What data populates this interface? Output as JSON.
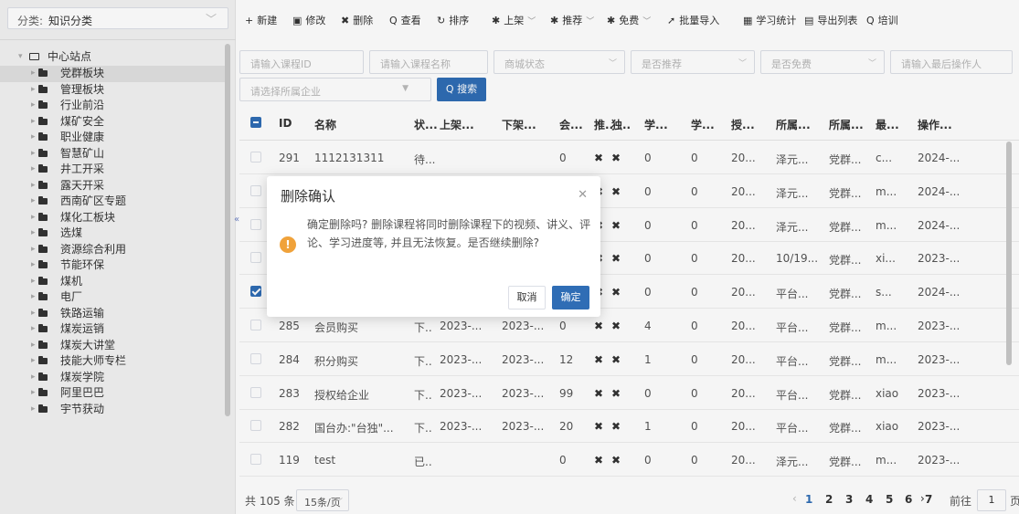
{
  "category": {
    "label": "分类:",
    "value": "知识分类"
  },
  "tree": {
    "root": "中心站点",
    "items": [
      "党群板块",
      "管理板块",
      "行业前沿",
      "煤矿安全",
      "职业健康",
      "智慧矿山",
      "井工开采",
      "露天开采",
      "西南矿区专题",
      "煤化工板块",
      "选煤",
      "资源综合利用",
      "节能环保",
      "煤机",
      "电厂",
      "铁路运输",
      "煤炭运销",
      "煤炭大讲堂",
      "技能大师专栏",
      "煤炭学院",
      "阿里巴巴",
      "宇节获动"
    ]
  },
  "toolbar": [
    {
      "glyph": "+",
      "label": "新建"
    },
    {
      "glyph": "▣",
      "label": "修改"
    },
    {
      "glyph": "✖",
      "label": "删除"
    },
    {
      "glyph": "Q",
      "label": "查看"
    },
    {
      "glyph": "↻",
      "label": "排序"
    },
    {
      "glyph": "✱",
      "label": "上架",
      "dd": true
    },
    {
      "glyph": "✱",
      "label": "推荐",
      "dd": true
    },
    {
      "glyph": "✱",
      "label": "免费",
      "dd": true
    },
    {
      "glyph": "➚",
      "label": "批量导入"
    },
    {
      "glyph": "▦",
      "label": "学习统计"
    },
    {
      "glyph": "▤",
      "label": "导出列表"
    },
    {
      "glyph": "Q",
      "label": "培训"
    }
  ],
  "filters": {
    "course_id": "请输入课程ID",
    "course_name": "请输入课程名称",
    "mall_status": "商城状态",
    "recommend": "是否推荐",
    "free": "是否免费",
    "last_operator": "请输入最后操作人",
    "company": "请选择所属企业",
    "search_button": "搜索"
  },
  "table": {
    "headers": [
      "ID",
      "名称",
      "状...",
      "上架...",
      "下架...",
      "会...",
      "推..",
      "独..",
      "学...",
      "学...",
      "授...",
      "所属...",
      "所属...",
      "最...",
      "操作..."
    ],
    "rows": [
      {
        "checked": false,
        "cells": [
          "291",
          "1112131311",
          "待...",
          "",
          "",
          "0",
          "✖",
          "✖",
          "0",
          "0",
          "20...",
          "泽元...",
          "党群...",
          "c...",
          "2024-..."
        ]
      },
      {
        "checked": false,
        "cells": [
          "",
          "",
          "",
          "",
          "",
          "",
          "✖",
          "✖",
          "0",
          "0",
          "20...",
          "泽元...",
          "党群...",
          "m...",
          "2024-..."
        ]
      },
      {
        "checked": false,
        "cells": [
          "",
          "",
          "",
          "",
          "",
          "",
          "✖",
          "✖",
          "0",
          "0",
          "20...",
          "泽元...",
          "党群...",
          "m...",
          "2024-..."
        ]
      },
      {
        "checked": false,
        "cells": [
          "",
          "",
          "",
          "",
          "",
          "",
          "✖",
          "✖",
          "0",
          "0",
          "20...",
          "10/19...",
          "党群...",
          "xi...",
          "2023-..."
        ]
      },
      {
        "checked": true,
        "cells": [
          "",
          "",
          "",
          "",
          "",
          "",
          "✖",
          "✖",
          "0",
          "0",
          "20...",
          "平台...",
          "党群...",
          "s...",
          "2024-..."
        ]
      },
      {
        "checked": false,
        "cells": [
          "285",
          "会员购买",
          "下..",
          "2023-...",
          "2023-...",
          "0",
          "✖",
          "✖",
          "4",
          "0",
          "20...",
          "平台...",
          "党群...",
          "m...",
          "2023-..."
        ]
      },
      {
        "checked": false,
        "cells": [
          "284",
          "积分购买",
          "下..",
          "2023-...",
          "2023-...",
          "12",
          "✖",
          "✖",
          "1",
          "0",
          "20...",
          "平台...",
          "党群...",
          "m...",
          "2023-..."
        ]
      },
      {
        "checked": false,
        "cells": [
          "283",
          "授权给企业",
          "下..",
          "2023-...",
          "2023-...",
          "99",
          "✖",
          "✖",
          "0",
          "0",
          "20...",
          "平台...",
          "党群...",
          "xiao",
          "2023-..."
        ]
      },
      {
        "checked": false,
        "cells": [
          "282",
          "国台办:\"台独\"...",
          "下..",
          "2023-...",
          "2023-...",
          "20",
          "✖",
          "✖",
          "1",
          "0",
          "20...",
          "平台...",
          "党群...",
          "xiao",
          "2023-..."
        ]
      },
      {
        "checked": false,
        "cells": [
          "119",
          "test",
          "已..",
          "",
          "",
          "0",
          "✖",
          "✖",
          "0",
          "0",
          "20...",
          "泽元...",
          "党群...",
          "m...",
          "2023-..."
        ]
      }
    ]
  },
  "pager": {
    "total": "共 105 条",
    "page_size": "15条/页",
    "pages": [
      "1",
      "2",
      "3",
      "4",
      "5",
      "6",
      "7"
    ],
    "current": "1",
    "goto_label": "前往",
    "goto_value": "1",
    "page_word": "页"
  },
  "dialog": {
    "title": "删除确认",
    "message": "确定删除吗? 删除课程将同时删除课程下的视频、讲义、评论、学习进度等, 并且无法恢复。是否继续删除?",
    "cancel": "取消",
    "confirm": "确定"
  },
  "colors": {
    "primary": "#2f6db5",
    "warning": "#f0a23a"
  }
}
